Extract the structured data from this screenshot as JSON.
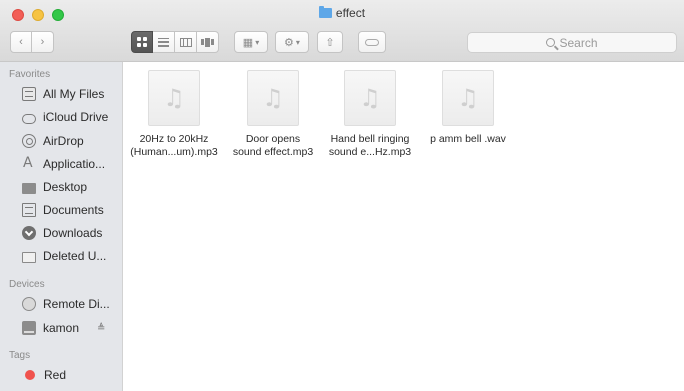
{
  "window": {
    "title": "effect"
  },
  "toolbar": {
    "back_icon": "chevron-left-icon",
    "forward_icon": "chevron-right-icon",
    "views": [
      "icon-view",
      "list-view",
      "column-view",
      "cover-flow-view"
    ],
    "active_view": "icon-view",
    "arrange_icon": "arrange-icon",
    "action_icon": "gear-icon",
    "share_icon": "share-icon",
    "tag_icon": "tag-icon",
    "search_placeholder": "Search"
  },
  "sidebar": {
    "favorites_header": "Favorites",
    "favorites": [
      {
        "label": "All My Files",
        "icon": "all-files-icon"
      },
      {
        "label": "iCloud Drive",
        "icon": "cloud-icon"
      },
      {
        "label": "AirDrop",
        "icon": "airdrop-icon"
      },
      {
        "label": "Applicatio...",
        "icon": "applications-icon"
      },
      {
        "label": "Desktop",
        "icon": "desktop-icon"
      },
      {
        "label": "Documents",
        "icon": "documents-icon"
      },
      {
        "label": "Downloads",
        "icon": "downloads-icon"
      },
      {
        "label": "Deleted U...",
        "icon": "folder-icon"
      }
    ],
    "devices_header": "Devices",
    "devices": [
      {
        "label": "Remote Di...",
        "icon": "remote-disc-icon"
      },
      {
        "label": "kamon",
        "icon": "drive-icon",
        "eject": "≜"
      }
    ],
    "tags_header": "Tags",
    "tags": [
      {
        "label": "Red",
        "color": "#f0524d"
      }
    ]
  },
  "files": [
    {
      "name_line1": "20Hz to 20kHz",
      "name_line2": "(Human...um).mp3",
      "icon": "audio-file-icon"
    },
    {
      "name_line1": "Door opens",
      "name_line2": "sound effect.mp3",
      "icon": "audio-file-icon"
    },
    {
      "name_line1": "Hand bell ringing",
      "name_line2": "sound e...Hz.mp3",
      "icon": "audio-file-icon"
    },
    {
      "name_line1": "p amm bell .wav",
      "name_line2": "",
      "icon": "audio-file-icon"
    }
  ]
}
